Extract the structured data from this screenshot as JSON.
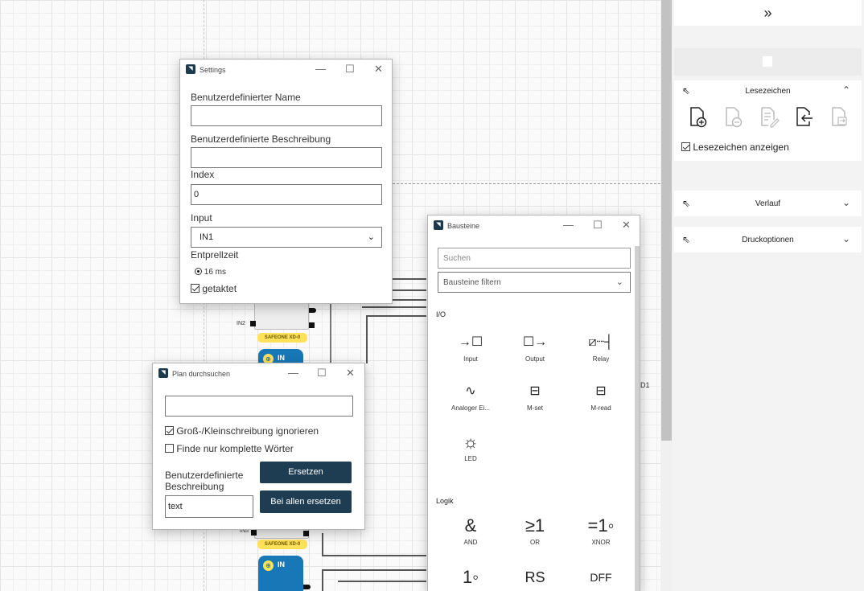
{
  "canvas": {
    "blocks": [
      {
        "label": "SAFEONE XD-0",
        "pin": "IN2",
        "in_chip": "IN"
      },
      {
        "label": "SAFEONE XD-0",
        "pin": "IN5",
        "in_chip": "IN"
      }
    ],
    "edge_label": "D1"
  },
  "right_panel": {
    "collapse_icon": "»",
    "bookmarks": {
      "title": "Lesezeichen",
      "show_label": "Lesezeichen anzeigen",
      "show_checked": true,
      "icons": [
        "add-bookmark-icon",
        "remove-bookmark-icon",
        "edit-bookmark-icon",
        "goto-bookmark-icon",
        "export-bookmark-icon"
      ]
    },
    "history": {
      "title": "Verlauf"
    },
    "print": {
      "title": "Druckoptionen"
    }
  },
  "settings": {
    "title": "Settings",
    "name_label": "Benutzerdefinierter Name",
    "name_value": "",
    "desc_label": "Benutzerdefinierte Beschreibung",
    "desc_value": "",
    "index_label": "Index",
    "index_value": "0",
    "input_label": "Input",
    "input_value": "IN1",
    "debounce_label": "Entprellzeit",
    "debounce_option": "16 ms",
    "clocked_label": "getaktet",
    "clocked_checked": true
  },
  "search": {
    "title": "Plan durchsuchen",
    "query": "",
    "ignore_case_label": "Groß-/Kleinschreibung ignorieren",
    "ignore_case_checked": true,
    "whole_words_label": "Finde nur komplette Wörter",
    "whole_words_checked": false,
    "replace_field_label": "Benutzerdefinierte Beschreibung",
    "replace_value": "text",
    "replace_button": "Ersetzen",
    "replace_all_button": "Bei allen ersetzen"
  },
  "palette": {
    "title": "Bausteine",
    "search_placeholder": "Suchen",
    "filter_value": "Bausteine filtern",
    "sections": [
      {
        "name": "I/O",
        "items": [
          {
            "label": "Input",
            "glyph": "→☐",
            "icon": "input-icon"
          },
          {
            "label": "Output",
            "glyph": "☐→",
            "icon": "output-icon"
          },
          {
            "label": "Relay",
            "glyph": "⧄┈┤",
            "icon": "relay-icon"
          },
          {
            "label": "Analoger Ei...",
            "glyph": "∿",
            "icon": "analog-input-icon"
          },
          {
            "label": "M-set",
            "glyph": "⊟",
            "icon": "m-set-icon"
          },
          {
            "label": "M-read",
            "glyph": "⊟",
            "icon": "m-read-icon"
          },
          {
            "label": "LED",
            "glyph": "☼",
            "icon": "led-icon"
          }
        ]
      },
      {
        "name": "Logik",
        "items": [
          {
            "label": "AND",
            "glyph": "&",
            "icon": "and-icon"
          },
          {
            "label": "OR",
            "glyph": "≥1",
            "icon": "or-icon"
          },
          {
            "label": "XNOR",
            "glyph": "=1◦",
            "icon": "xnor-icon"
          },
          {
            "label": "",
            "glyph": "1◦",
            "icon": "not-icon"
          },
          {
            "label": "",
            "glyph": "RS",
            "icon": "rs-icon"
          },
          {
            "label": "",
            "glyph": "DFF",
            "icon": "dff-icon"
          }
        ]
      }
    ]
  }
}
